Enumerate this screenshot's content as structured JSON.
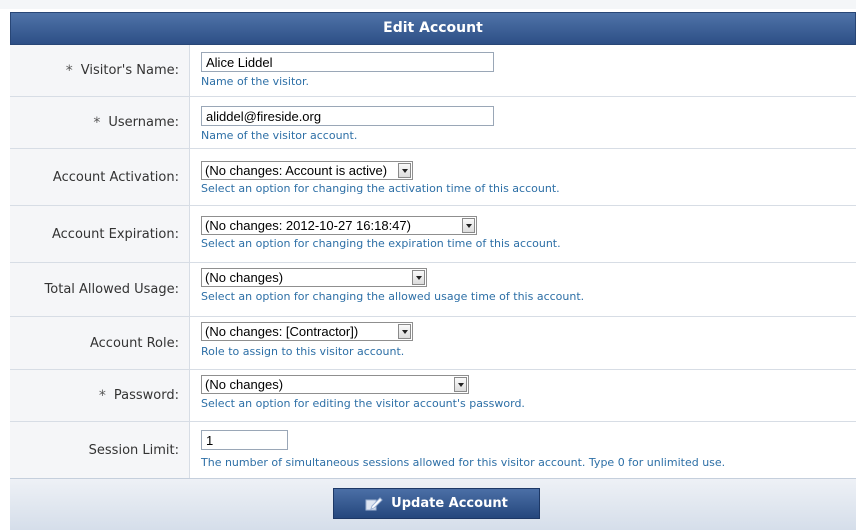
{
  "form": {
    "title": "Edit Account",
    "rows": [
      {
        "label": "Visitor's Name:",
        "required": "*",
        "value": "Alice Liddel",
        "hint": "Name of the visitor."
      },
      {
        "label": "Username:",
        "required": "*",
        "value": "aliddel@fireside.org",
        "hint": "Name of the visitor account."
      },
      {
        "label": "Account Activation:",
        "value": "(No changes: Account is active)",
        "hint": "Select an option for changing the activation time of this account."
      },
      {
        "label": "Account Expiration:",
        "value": "(No changes: 2012-10-27 16:18:47)",
        "hint": "Select an option for changing the expiration time of this account."
      },
      {
        "label": "Total Allowed Usage:",
        "value": "(No changes)",
        "hint": "Select an option for changing the allowed usage time of this account."
      },
      {
        "label": "Account Role:",
        "value": "(No changes: [Contractor])",
        "hint": "Role to assign to this visitor account."
      },
      {
        "label": "Password:",
        "required": "*",
        "value": "(No changes)",
        "hint": "Select an option for editing the visitor account's password."
      },
      {
        "label": "Session Limit:",
        "value": "1",
        "hint": "The number of simultaneous sessions allowed for this visitor account. Type 0 for unlimited use."
      }
    ],
    "submit_label": "Update Account"
  },
  "icons": {
    "submit": "edit-pencil-icon"
  }
}
